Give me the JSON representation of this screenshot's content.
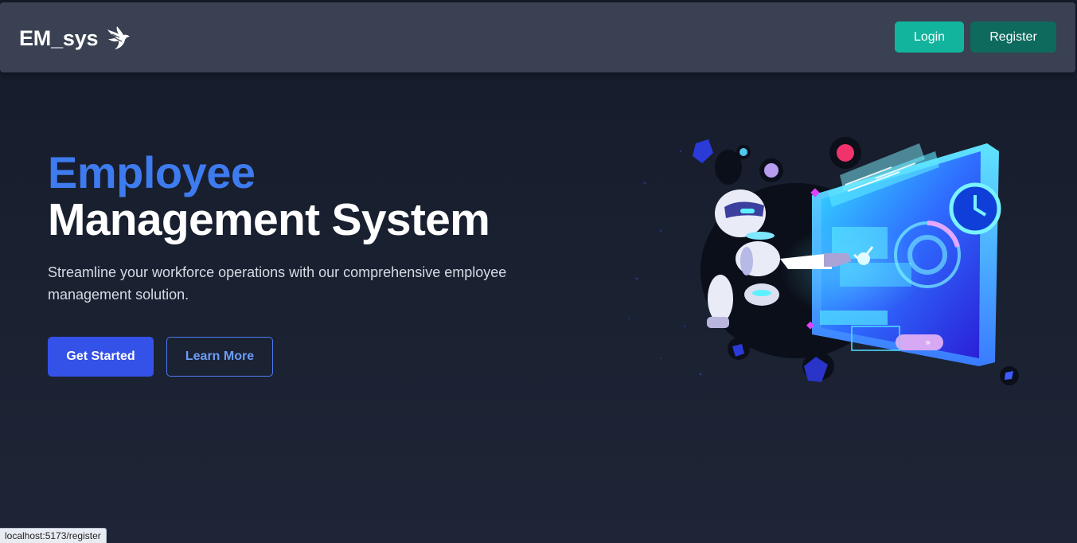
{
  "navbar": {
    "brand": "EM_sys",
    "brand_icon": "bird-icon",
    "login_label": "Login",
    "register_label": "Register"
  },
  "hero": {
    "title_line1": "Employee",
    "title_line2": "Management System",
    "subtitle": "Streamline your workforce operations with our comprehensive employee management solution.",
    "primary_cta": "Get Started",
    "secondary_cta": "Learn More",
    "illustration": "robot-dashboard-illustration"
  },
  "status_bar": {
    "url": "localhost:5173/register"
  },
  "colors": {
    "background": "#1a2131",
    "navbar": "#394152",
    "accent_blue": "#3e7bef",
    "login": "#13b49e",
    "register": "#0f6a5e",
    "primary_cta": "#3552e8"
  }
}
